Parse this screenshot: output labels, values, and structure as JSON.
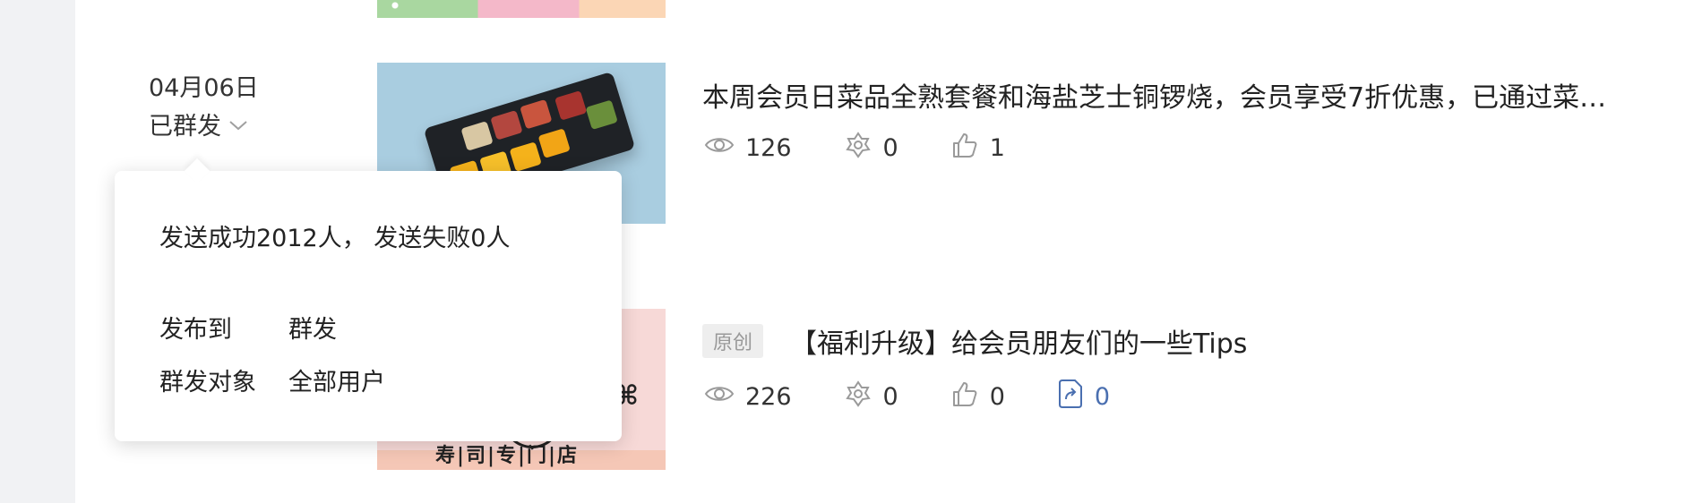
{
  "articles": [
    {
      "date": "04月06日",
      "status": "已群发",
      "title": "本周会员日菜品全熟套餐和海盐芝士铜锣烧，会员享受7折优惠，已通过菜…",
      "stats": {
        "views": "126",
        "favorites": "0",
        "likes": "1"
      }
    },
    {
      "badge": "原创",
      "title": "【福利升级】给会员朋友们的一些Tips",
      "stats": {
        "views": "226",
        "favorites": "0",
        "likes": "0",
        "shares": "0"
      },
      "thumb_text": "寿|司|专|门|店"
    }
  ],
  "popover": {
    "summary": "发送成功2012人， 发送失败0人",
    "publish_label": "发布到",
    "publish_value": "群发",
    "audience_label": "群发对象",
    "audience_value": "全部用户"
  },
  "colors": {
    "icon": "#9a9a9a",
    "share_accent": "#4a6fb0",
    "gutter": "#f1f2f4"
  },
  "icons": [
    "eye-icon",
    "favorite-icon",
    "thumbs-up-icon",
    "share-icon",
    "chevron-down-icon"
  ]
}
